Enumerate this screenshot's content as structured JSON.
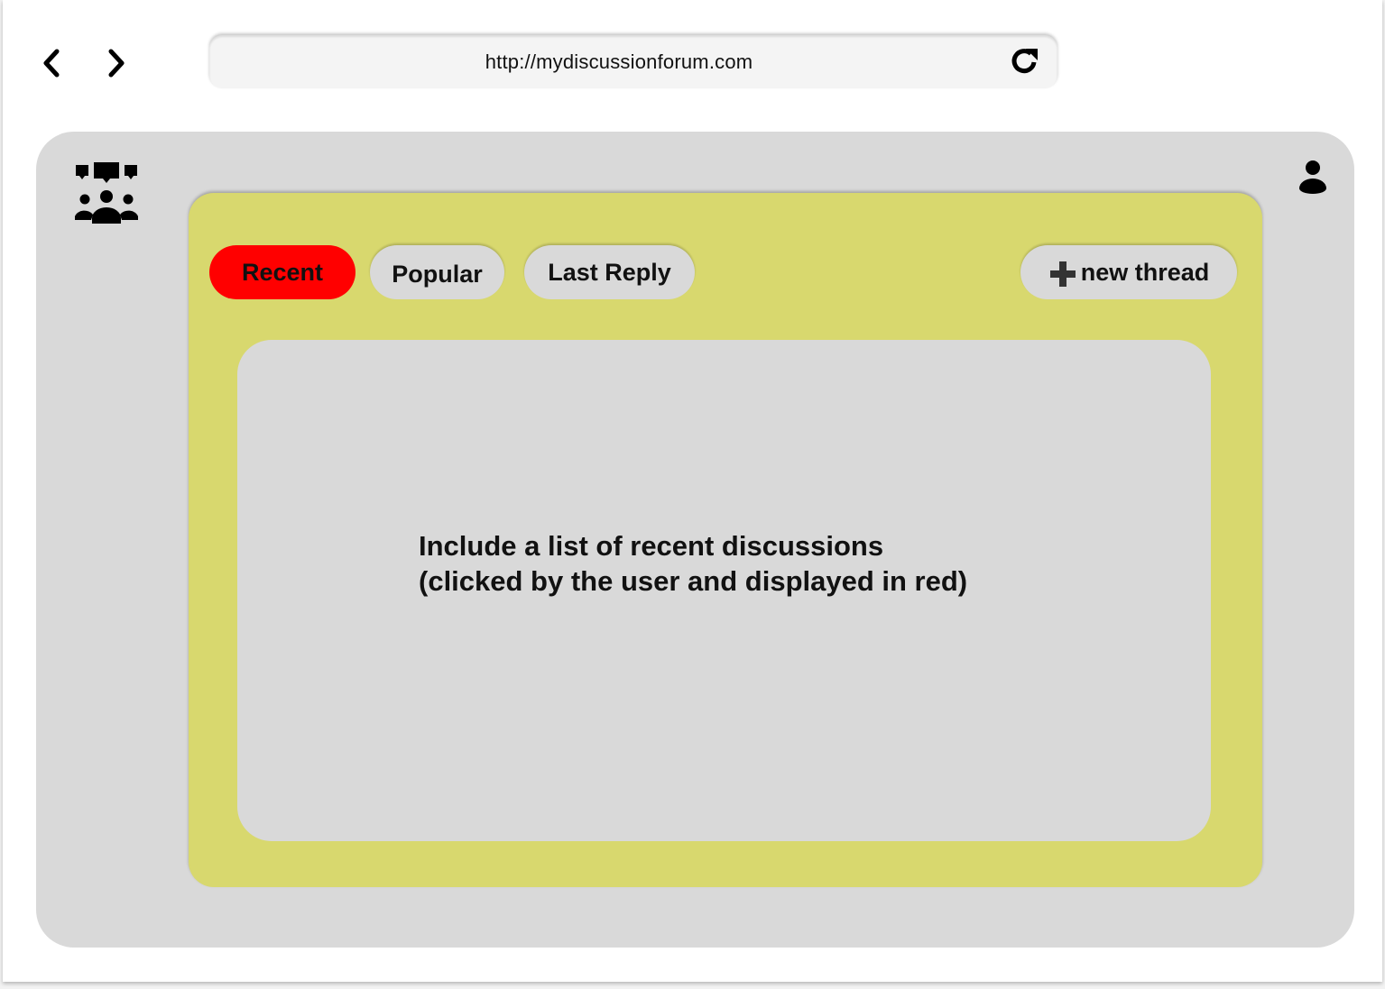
{
  "browser": {
    "url": "http://mydiscussionforum.com",
    "back_icon": "chevron-left-icon",
    "forward_icon": "chevron-right-icon",
    "reload_icon": "reload-icon"
  },
  "app": {
    "logo_icon": "forum-community-icon",
    "user_icon": "user-icon"
  },
  "tabs": [
    {
      "label": "Recent",
      "active": true
    },
    {
      "label": "Popular",
      "active": false
    },
    {
      "label": "Last Reply",
      "active": false
    }
  ],
  "new_thread": {
    "label": "new thread",
    "icon": "plus-icon"
  },
  "content": {
    "note_line1": "Include a list of recent discussions",
    "note_line2": "(clicked by the user and displayed in red)"
  },
  "colors": {
    "active_tab": "#ff0000",
    "panel": "#d8d86e",
    "surface": "#d9d9d9"
  }
}
